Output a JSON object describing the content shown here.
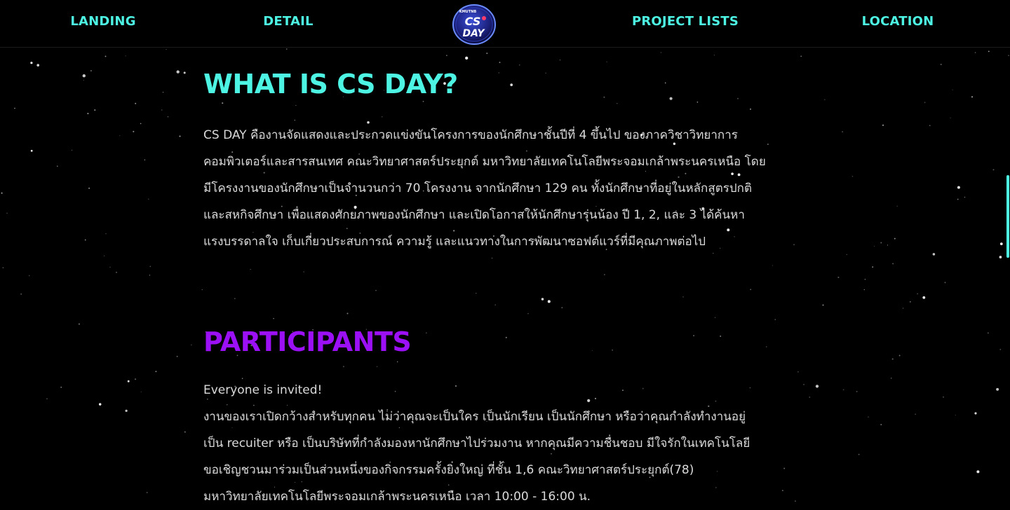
{
  "nav": {
    "items": [
      {
        "label": "LANDING"
      },
      {
        "label": "DETAIL"
      },
      {
        "label": "PROJECT LISTS"
      },
      {
        "label": "LOCATION"
      }
    ],
    "logo": {
      "top_text": "KMUTNB",
      "line1": "CS",
      "line2": "DAY"
    }
  },
  "colors": {
    "accent_cyan": "#4df3e3",
    "accent_purple": "#9b10f5",
    "body_text": "#dadada",
    "background": "#000000"
  },
  "about": {
    "heading": "WHAT IS CS DAY?",
    "lines": [
      "CS DAY คืองานจัดแสดงและประกวดแข่งขันโครงการของนักศึกษาชั้นปีที่ 4 ขึ้นไป ของภาควิชาวิทยาการ",
      "คอมพิวเตอร์และสารสนเทศ คณะวิทยาศาสตร์ประยุกต์ มหาวิทยาลัยเทคโนโลยีพระจอมเกล้าพระนครเหนือ โดย",
      "มีโครงงานของนักศึกษาเป็นจำนวนกว่า 70 โครงงาน จากนักศึกษา 129 คน ทั้งนักศึกษาที่อยู่ในหลักสูตรปกติ",
      "และสหกิจศึกษา เพื่อแสดงศักยภาพของนักศึกษา และเปิดโอกาสให้นักศึกษารุ่นน้อง ปี 1, 2, และ 3 ได้ค้นหา",
      "แรงบรรดาลใจ เก็บเกี่ยวประสบการณ์ ความรู้ และแนวทางในการพัฒนาซอฟต์แวร์ที่มีคุณภาพต่อไป"
    ]
  },
  "participants": {
    "heading": "PARTICIPANTS",
    "lines": [
      "Everyone is invited!",
      "งานของเราเปิดกว้างสำหรับทุกคน ไม่ว่าคุณจะเป็นใคร เป็นนักเรียน เป็นนักศึกษา หรือว่าคุณกำลังทำงานอยู่",
      "เป็น recuiter หรือ เป็นบริษัทที่กำลังมองหานักศึกษาไปร่วมงาน หากคุณมีความชื่นชอบ มีใจรักในเทคโนโลยี",
      "ขอเชิญชวนมาร่วมเป็นส่วนหนึ่งของกิจกรรมครั้งยิ่งใหญ่ ที่ชั้น 1,6 คณะวิทยาศาสตร์ประยุกต์(78)",
      "มหาวิทยาลัยเทคโนโลยีพระจอมเกล้าพระนครเหนือ เวลา 10:00 - 16:00 น."
    ]
  }
}
